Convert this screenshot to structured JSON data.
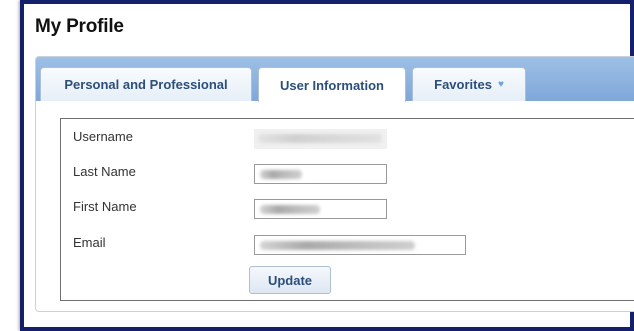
{
  "page": {
    "title": "My Profile"
  },
  "tabs": [
    {
      "label": "Personal and Professional",
      "active": false
    },
    {
      "label": "User Information",
      "active": true
    },
    {
      "label": "Favorites",
      "active": false,
      "icon": "heart-icon"
    }
  ],
  "form": {
    "fields": [
      {
        "label": "Username",
        "value": "",
        "readonly": true,
        "blurred": true
      },
      {
        "label": "Last Name",
        "value": "",
        "blurred": true
      },
      {
        "label": "First Name",
        "value": "",
        "blurred": true
      },
      {
        "label": "Email",
        "value": "",
        "blurred": true
      }
    ],
    "update_label": "Update"
  },
  "colors": {
    "frame_border": "#14206b",
    "tabbar": "#8fb4e0",
    "tab_text": "#2b4f7a"
  }
}
